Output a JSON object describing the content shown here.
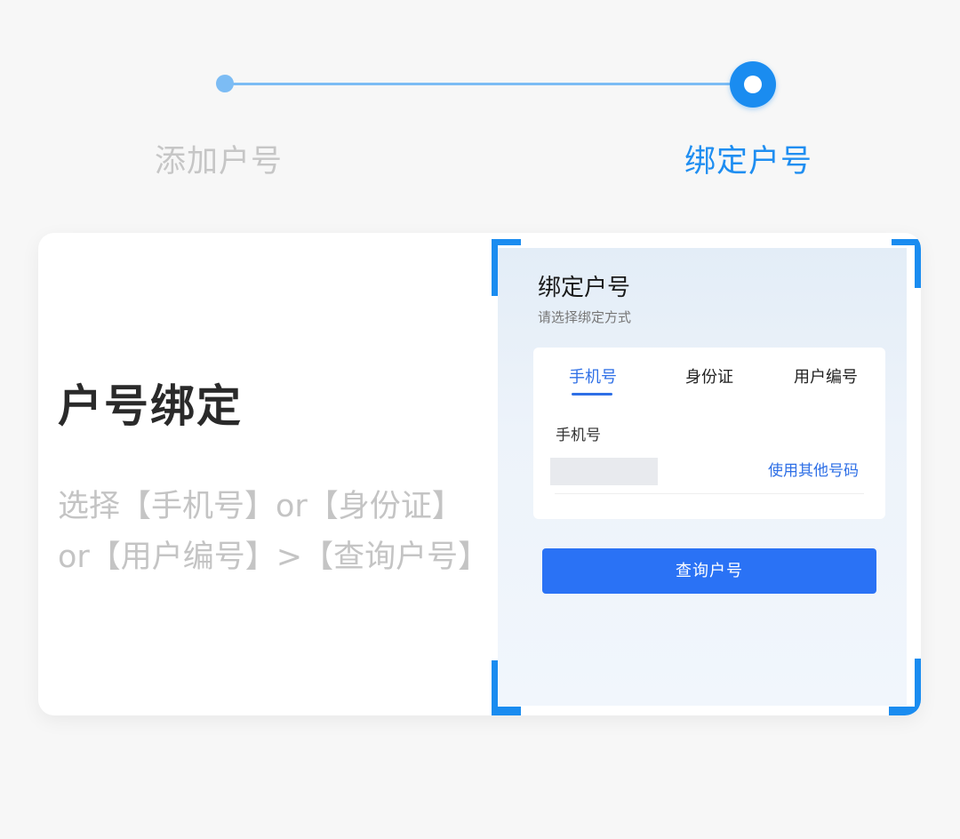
{
  "stepper": {
    "step1_label": "添加户号",
    "step2_label": "绑定户号",
    "active_step": 2,
    "colors": {
      "inactive_text": "#c6c6c6",
      "active_text": "#1f8ef1",
      "line": "#7cbcf4",
      "active_dot": "#1a8cf0"
    }
  },
  "card": {
    "title": "户号绑定",
    "description_line1": "选择【手机号】or【身份证】",
    "description_line2": "or【用户编号】>【查询户号】"
  },
  "mockup": {
    "title": "绑定户号",
    "subtitle": "请选择绑定方式",
    "tabs": [
      {
        "label": "手机号",
        "active": true
      },
      {
        "label": "身份证",
        "active": false
      },
      {
        "label": "用户编号",
        "active": false
      }
    ],
    "field_label": "手机号",
    "other_number_link": "使用其他号码",
    "query_button": "查询户号",
    "accent_color": "#2e6fe6",
    "button_color": "#2a72f5"
  }
}
